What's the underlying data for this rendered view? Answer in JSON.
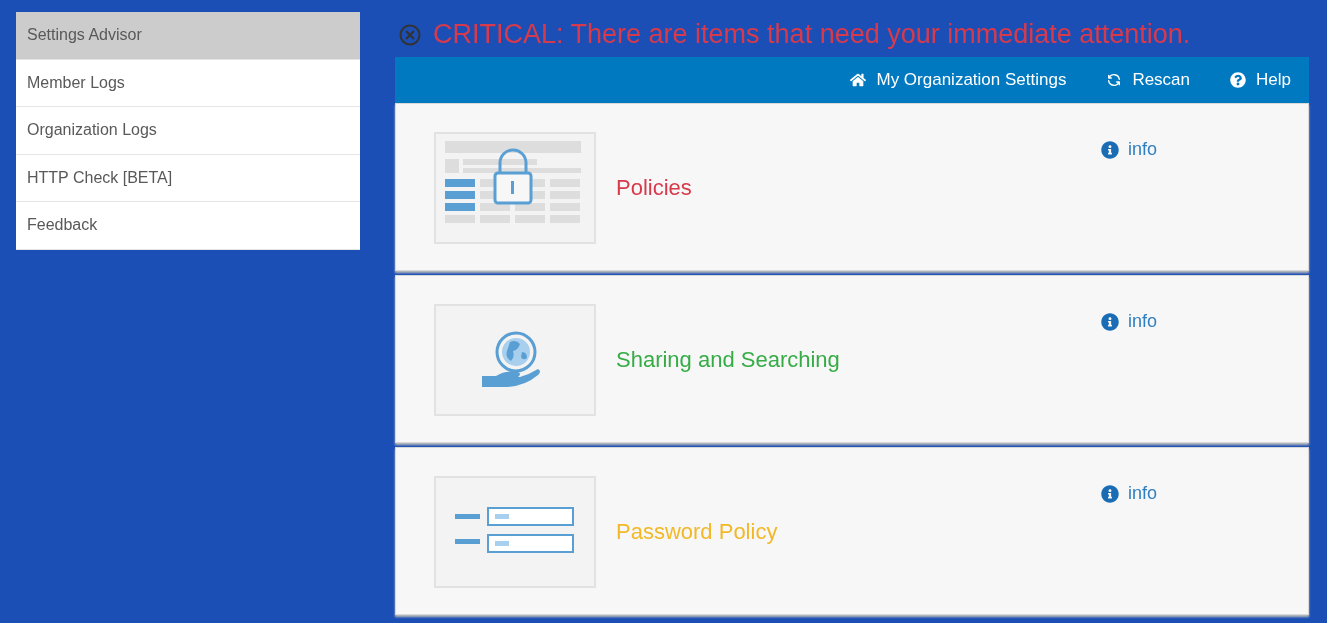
{
  "sidebar": {
    "items": [
      {
        "label": "Settings Advisor",
        "selected": true
      },
      {
        "label": "Member Logs",
        "selected": false
      },
      {
        "label": "Organization Logs",
        "selected": false
      },
      {
        "label": "HTTP Check [BETA]",
        "selected": false
      },
      {
        "label": "Feedback",
        "selected": false
      }
    ]
  },
  "alert": {
    "text": "CRITICAL: There are items that need your immediate attention."
  },
  "toolbar": {
    "items": [
      {
        "kind": "home",
        "label": "My Organization Settings"
      },
      {
        "kind": "rescan",
        "label": "Rescan"
      },
      {
        "kind": "help",
        "label": "Help"
      }
    ]
  },
  "cards": [
    {
      "kind": "policies",
      "title": "Policies",
      "color": "#d83a4c",
      "info": "info"
    },
    {
      "kind": "sharing",
      "title": "Sharing and Searching",
      "color": "#35ac46",
      "info": "info"
    },
    {
      "kind": "password",
      "title": "Password Policy",
      "color": "#f2b828",
      "info": "info"
    }
  ]
}
